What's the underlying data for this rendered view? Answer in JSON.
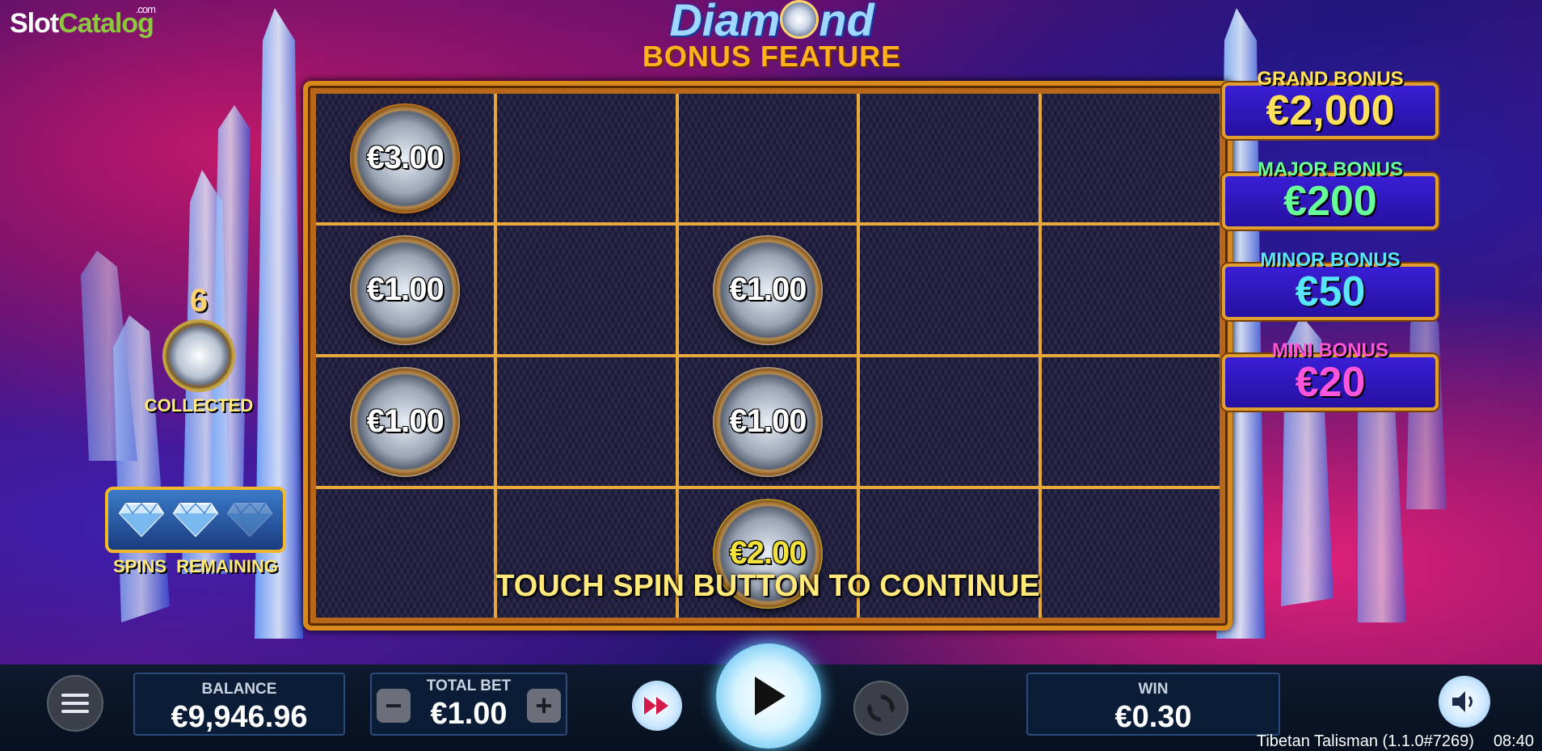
{
  "logo": {
    "slot": "Slot",
    "catalog": "Catalog",
    "com": ".com"
  },
  "title": {
    "main_before": "Diam",
    "main_after": "nd",
    "sub": "BONUS FEATURE"
  },
  "grid": {
    "rows": [
      [
        {
          "value": "€3.00",
          "type": "orange"
        },
        null,
        null,
        null,
        null
      ],
      [
        {
          "value": "€1.00",
          "type": "silver"
        },
        null,
        {
          "value": "€1.00",
          "type": "silver"
        },
        null,
        null
      ],
      [
        {
          "value": "€1.00",
          "type": "silver"
        },
        null,
        {
          "value": "€1.00",
          "type": "silver"
        },
        null,
        null
      ],
      [
        null,
        null,
        {
          "value": "€2.00",
          "type": "gold"
        },
        null,
        null
      ]
    ]
  },
  "message": "TOUCH SPIN BUTTON TO CONTINUE",
  "jackpots": {
    "grand": {
      "label": "GRAND BONUS",
      "value": "€2,000",
      "color": "#ffe05c"
    },
    "major": {
      "label": "MAJOR BONUS",
      "value": "€200",
      "color": "#66ff9a"
    },
    "minor": {
      "label": "MINOR BONUS",
      "value": "€50",
      "color": "#58e6ff"
    },
    "mini": {
      "label": "MINI BONUS",
      "value": "€20",
      "color": "#ff55dd"
    }
  },
  "collected": {
    "count": "6",
    "label": "COLLECTED"
  },
  "spins_remaining": {
    "label": "SPINS REMAINING",
    "total": 3,
    "remaining": 2
  },
  "bottom": {
    "balance_label": "BALANCE",
    "balance_value": "€9,946.96",
    "bet_label": "TOTAL BET",
    "bet_value": "€1.00",
    "bet_minus": "−",
    "bet_plus": "+",
    "win_label": "WIN",
    "win_value": "€0.30"
  },
  "icons": {
    "menu": "hamburger-menu-icon",
    "fast_forward": "fast-forward-icon",
    "spin": "play-icon",
    "autoplay": "autoplay-icon",
    "sound": "speaker-icon"
  },
  "footer": {
    "game": "Tibetan Talisman (1.1.0#7269)",
    "time": "08:40"
  }
}
